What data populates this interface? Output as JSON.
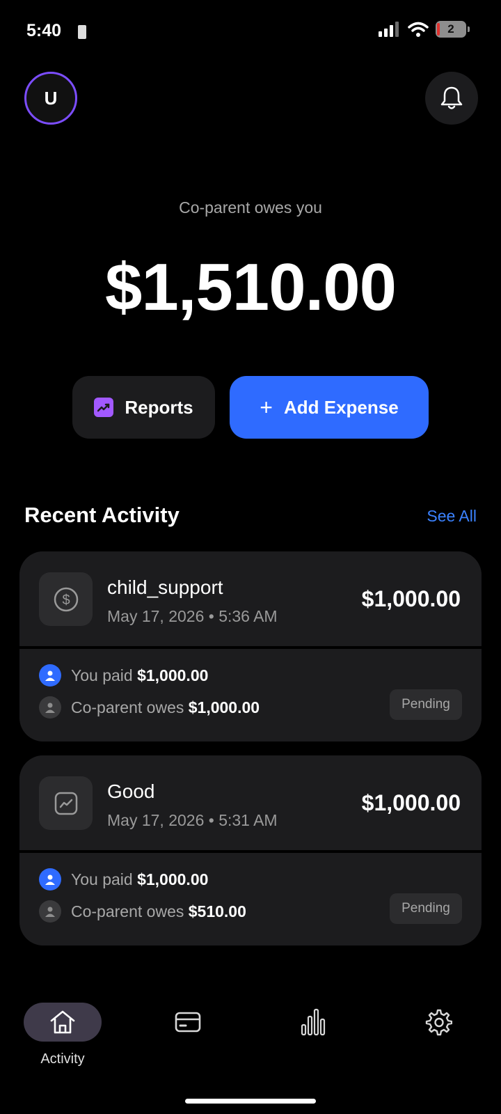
{
  "status_bar": {
    "time": "5:40",
    "battery": "2"
  },
  "header": {
    "avatar_initial": "U"
  },
  "balance": {
    "label": "Co-parent owes you",
    "amount": "$1,510.00"
  },
  "actions": {
    "reports_label": "Reports",
    "add_expense_label": "Add Expense"
  },
  "recent_activity": {
    "title": "Recent Activity",
    "see_all": "See All",
    "items": [
      {
        "icon": "dollar-circle-icon",
        "title": "child_support",
        "date": "May 17, 2026 • 5:36 AM",
        "amount": "$1,000.00",
        "you_paid_label": "You paid",
        "you_paid_amount": "$1,000.00",
        "coparent_label": "Co-parent owes",
        "coparent_amount": "$1,000.00",
        "status": "Pending"
      },
      {
        "icon": "trend-chart-icon",
        "title": "Good",
        "date": "May 17, 2026 • 5:31 AM",
        "amount": "$1,000.00",
        "you_paid_label": "You paid",
        "you_paid_amount": "$1,000.00",
        "coparent_label": "Co-parent owes",
        "coparent_amount": "$510.00",
        "status": "Pending"
      }
    ]
  },
  "nav": {
    "items": [
      {
        "icon": "home-icon",
        "label": "Activity",
        "active": true
      },
      {
        "icon": "card-icon",
        "label": "",
        "active": false
      },
      {
        "icon": "bar-chart-icon",
        "label": "",
        "active": false
      },
      {
        "icon": "gear-icon",
        "label": "",
        "active": false
      }
    ]
  },
  "colors": {
    "accent_blue": "#2f6bff",
    "avatar_ring": "#7c4dff",
    "reports_icon": "#a259ff",
    "link": "#3b82ff"
  }
}
